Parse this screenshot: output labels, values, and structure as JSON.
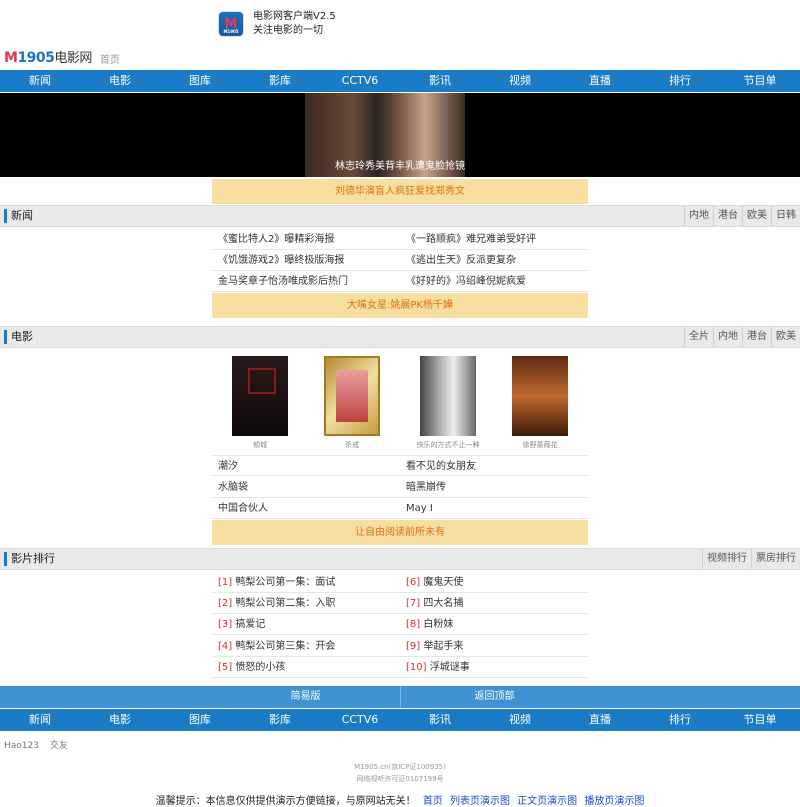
{
  "app": {
    "logo_text": "M",
    "logo_small": "M1905",
    "title": "电影网客户端V2.5",
    "slogan": "关注电影的一切"
  },
  "site": {
    "logo_m": "M",
    "logo_num": "1905",
    "logo_cn": "电影网",
    "home": "首页"
  },
  "nav": [
    "新闻",
    "电影",
    "图库",
    "影库",
    "CCTV6",
    "影讯",
    "视频",
    "直播",
    "排行",
    "节目单"
  ],
  "banner": {
    "caption": "林志玲秀美背丰乳遭鬼脸抢镜"
  },
  "headlines": [
    "刘德华演盲人疯狂爱找郑秀文",
    "大嘴女星:姚晨PK杨千嬅",
    "让自由阅读前所未有"
  ],
  "news": {
    "title": "新闻",
    "tabs": [
      "内地",
      "港台",
      "欧美",
      "日韩"
    ],
    "rows": [
      [
        "《蜜比特人2》曝精彩海报",
        "《一路顺疯》难兄难弟受好评"
      ],
      [
        "《饥饿游戏2》曝终极版海报",
        "《逃出生天》反派更复杂"
      ],
      [
        "金马奖章子怡汤唯成影后热门",
        "《好好的》冯绍峰倪妮疯爱"
      ]
    ]
  },
  "movies": {
    "title": "电影",
    "tabs": [
      "全片",
      "内地",
      "港台",
      "欧美"
    ],
    "posters": [
      "傾城",
      "杀戒",
      "快乐的方式不止一种",
      "徐野蔷薇花"
    ],
    "rows": [
      [
        "潮汐",
        "看不见的女朋友"
      ],
      [
        "水脑袋",
        "暗黑崩传"
      ],
      [
        "中国合伙人",
        "May I"
      ]
    ]
  },
  "ranking": {
    "title": "影片排行",
    "tabs": [
      "视频排行",
      "票房排行"
    ],
    "rows": [
      [
        {
          "n": "[1]",
          "t": "鸭梨公司第一集：面试"
        },
        {
          "n": "[6]",
          "t": "魔鬼天使"
        }
      ],
      [
        {
          "n": "[2]",
          "t": "鸭梨公司第二集：入职"
        },
        {
          "n": "[7]",
          "t": "四大名捕"
        }
      ],
      [
        {
          "n": "[3]",
          "t": "搞爱记"
        },
        {
          "n": "[8]",
          "t": "白粉妹"
        }
      ],
      [
        {
          "n": "[4]",
          "t": "鸭梨公司第三集：开会"
        },
        {
          "n": "[9]",
          "t": "举起手来"
        }
      ],
      [
        {
          "n": "[5]",
          "t": "愤怒的小孩"
        },
        {
          "n": "[10]",
          "t": "浮城谜事"
        }
      ]
    ]
  },
  "footer": {
    "simple": "简易版",
    "back_top": "返回顶部",
    "friends": [
      "Hao123",
      "交友"
    ],
    "icp1": "M1905.cn(京ICP证100935)",
    "icp2": "网络视听许可证0107199号",
    "notice": "温馨提示：本信息仅供提供演示方便链接，与原网站无关！",
    "links": [
      "首页",
      "列表页演示图",
      "正文页演示图",
      "播放页演示图"
    ]
  }
}
